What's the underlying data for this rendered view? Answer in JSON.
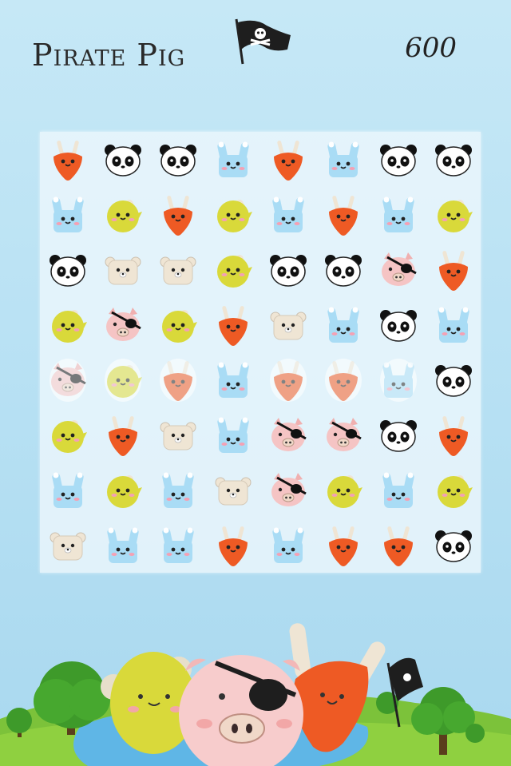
{
  "title": "Pirate Pig",
  "score": "600",
  "colors": {
    "carrot": "#ee5a24",
    "bunny": "#a9dcf5",
    "lemon": "#d9d93a",
    "pig": "#f5c4c4",
    "bear": "#efe5d4",
    "panda": "#ffffff"
  },
  "board": [
    [
      "carrot",
      "panda",
      "panda",
      "bunny",
      "carrot",
      "bunny",
      "panda",
      "panda"
    ],
    [
      "bunny",
      "lemon",
      "carrot",
      "lemon",
      "bunny",
      "carrot",
      "bunny",
      "lemon"
    ],
    [
      "panda",
      "bear",
      "bear",
      "lemon",
      "panda",
      "panda",
      "pig",
      "carrot"
    ],
    [
      "lemon",
      "pig",
      "lemon",
      "carrot",
      "bear",
      "bunny",
      "panda",
      "bunny"
    ],
    [
      "pig",
      "lemon",
      "carrot",
      "bunny",
      "carrot",
      "carrot",
      "bunny",
      "panda"
    ],
    [
      "lemon",
      "carrot",
      "bear",
      "bunny",
      "pig",
      "pig",
      "panda",
      "carrot"
    ],
    [
      "bunny",
      "lemon",
      "bunny",
      "bear",
      "pig",
      "lemon",
      "bunny",
      "lemon"
    ],
    [
      "bear",
      "bunny",
      "bunny",
      "carrot",
      "bunny",
      "carrot",
      "carrot",
      "panda"
    ]
  ],
  "faded_tiles": [
    "4-0",
    "4-1",
    "4-2",
    "4-4",
    "4-5",
    "4-6"
  ]
}
